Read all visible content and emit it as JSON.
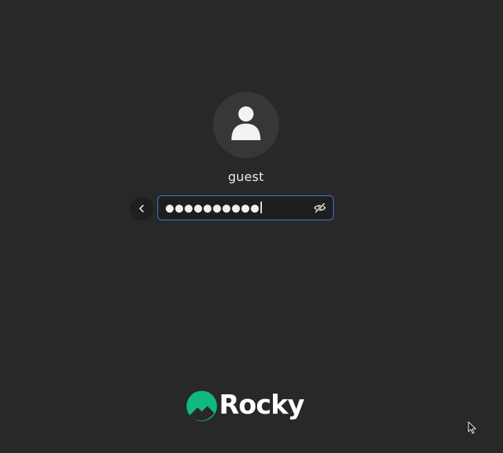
{
  "login": {
    "username": "guest",
    "password_masked": "●●●●●●●●●●",
    "focus_color": "#3584e4"
  },
  "icons": {
    "avatar": "user-silhouette-icon",
    "back": "chevron-left-icon",
    "reveal": "eye-slash-icon",
    "pointer": "mouse-pointer-icon"
  },
  "branding": {
    "logo_text": "Rocky",
    "logo_color": "#10b981"
  }
}
